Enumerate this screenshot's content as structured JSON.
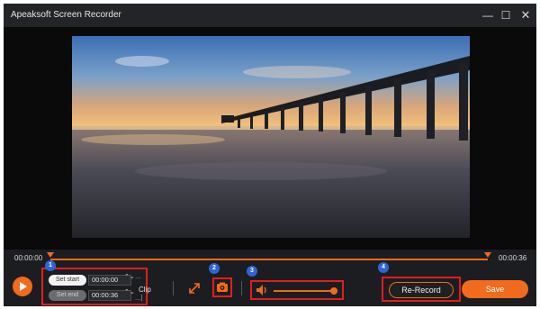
{
  "window": {
    "title": "Apeaksoft Screen Recorder",
    "controls": {
      "minimize": "—",
      "maximize": "☐",
      "close": "✕"
    }
  },
  "timeline": {
    "start_time": "00:00:00",
    "end_time": "00:00:36",
    "accent_color": "#f26a1b"
  },
  "clip": {
    "set_start_label": "Set start",
    "start_value": "00:00:00",
    "set_end_label": "Set end",
    "end_value": "00:00:36",
    "label": "Clip",
    "spinner_glyph": "⌃⌄",
    "dots": "...",
    "bracket": "...|"
  },
  "badges": {
    "one": "1",
    "two": "2",
    "three": "3",
    "four": "4"
  },
  "tools": {
    "expand_icon": "expand-icon",
    "camera_icon": "camera-icon",
    "volume_icon": "speaker-icon",
    "volume_level": 0.95
  },
  "actions": {
    "rerecord_label": "Re-Record",
    "save_label": "Save"
  },
  "colors": {
    "accent": "#f26a1b",
    "highlight_box": "#e01e1e",
    "badge": "#2f63d8"
  }
}
